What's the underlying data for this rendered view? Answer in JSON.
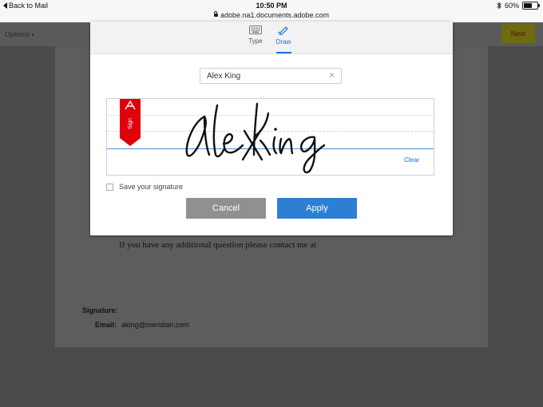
{
  "statusbar": {
    "back_label": "Back to Mail",
    "time": "10:50 PM",
    "url": "adobe.na1.documents.adobe.com",
    "battery": "60%",
    "battery_level": 0.6
  },
  "toolbar": {
    "options_label": "Options",
    "next_label": "Next"
  },
  "document": {
    "contact_text": "If you have any additional question please contact me at",
    "signature_label": "Signature:",
    "email_label": "Email:",
    "email_value": "aking@meridian.com"
  },
  "modal": {
    "tabs": [
      {
        "label": "Type",
        "icon": "keyboard-icon",
        "active": false
      },
      {
        "label": "Draw",
        "icon": "pen-icon",
        "active": true
      }
    ],
    "name_value": "Alex King",
    "ribbon_text": "Sign",
    "clear_label": "Clear",
    "save_label": "Save your signature",
    "cancel_label": "Cancel",
    "apply_label": "Apply",
    "accent_color": "#1473e6",
    "brand_red": "#e0000b"
  }
}
